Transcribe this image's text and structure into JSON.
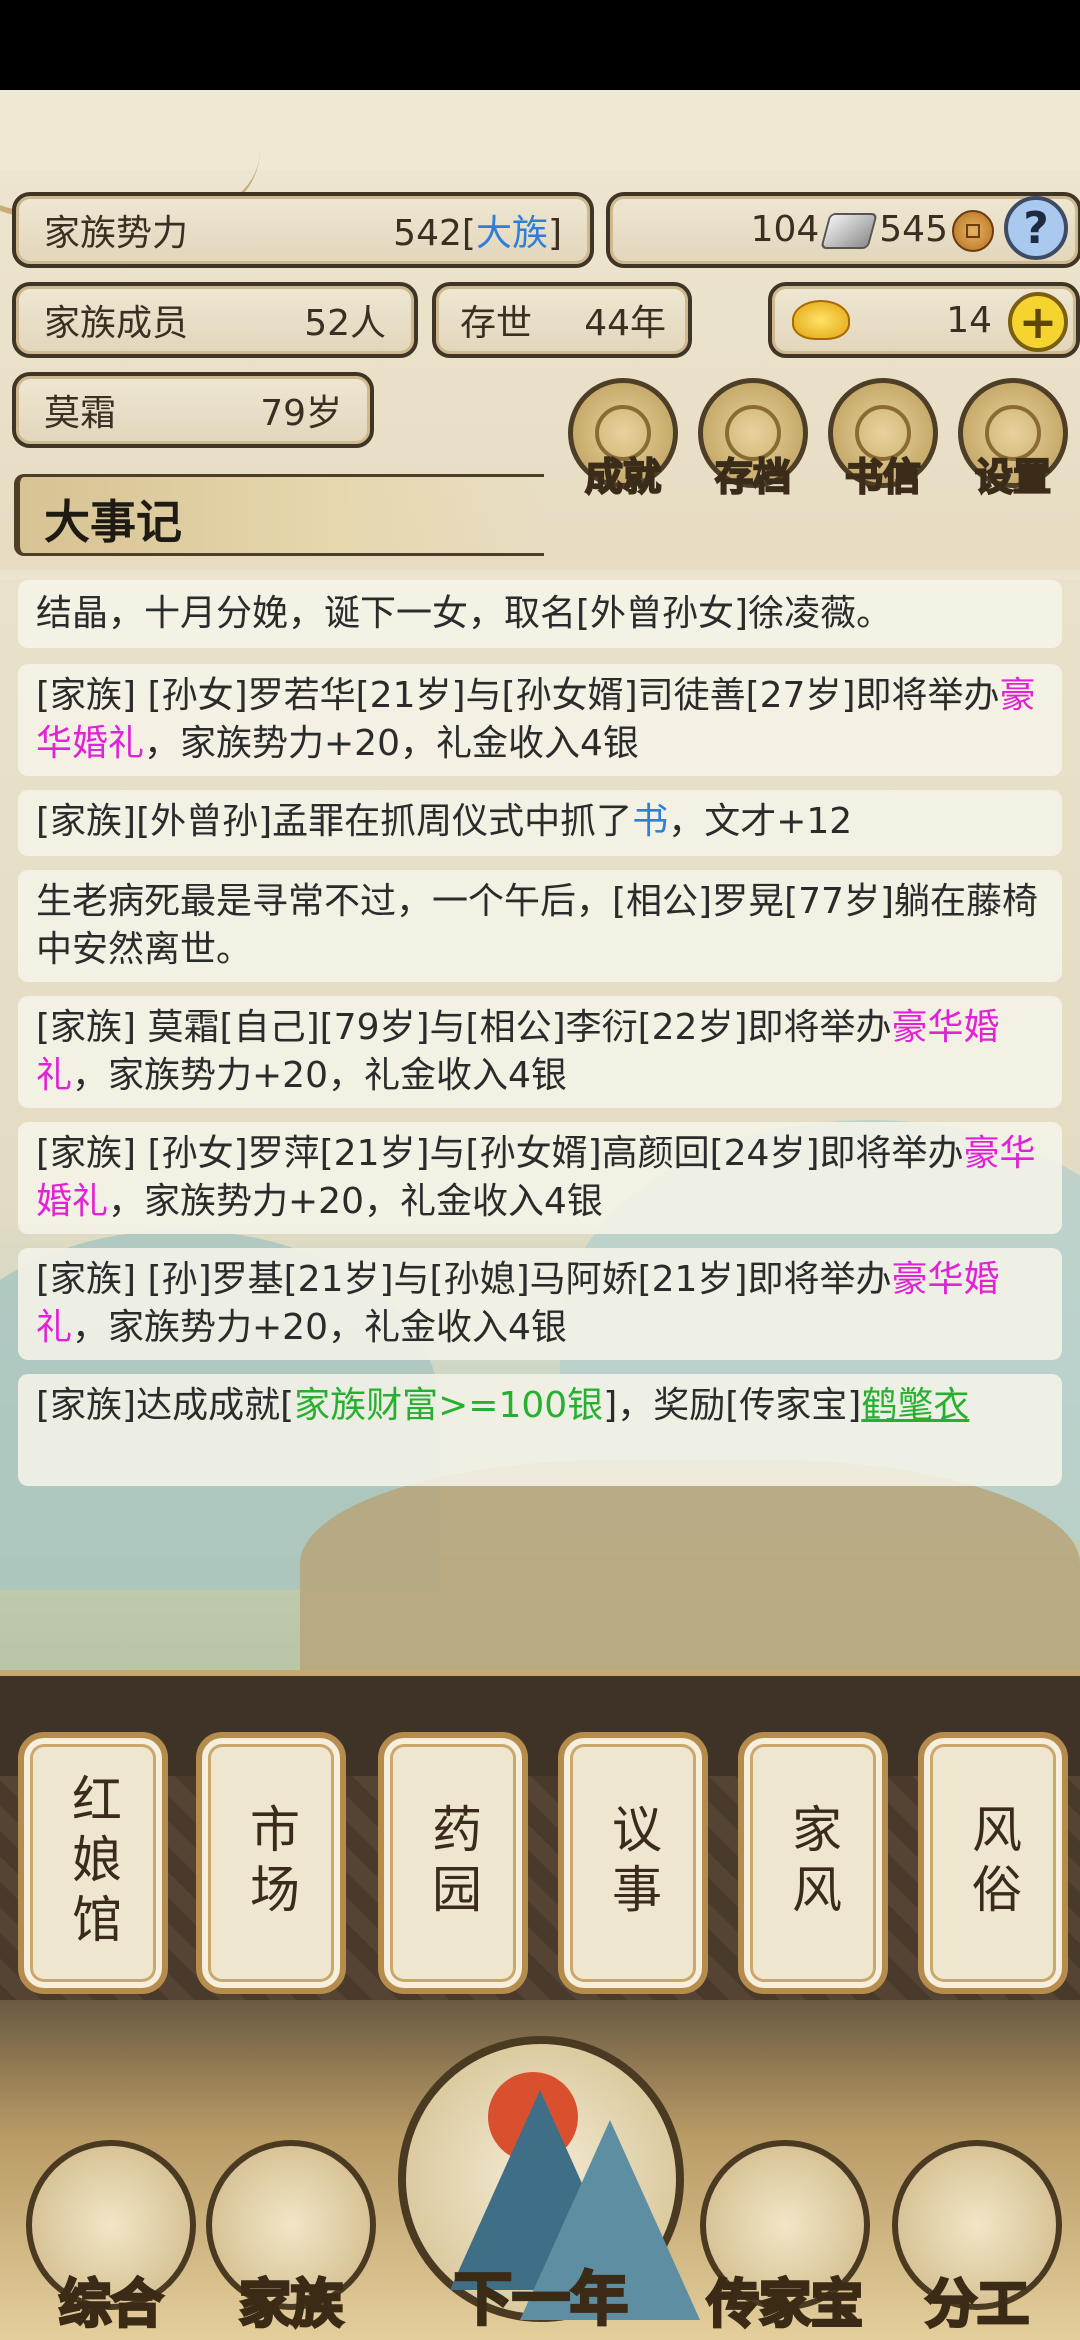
{
  "stats": {
    "power_label": "家族势力",
    "power_value": "542",
    "power_rank": "大族",
    "silver": "104",
    "copper": "545",
    "help": "?",
    "members_label": "家族成员",
    "members_value": "52人",
    "exist_label": "存世",
    "exist_value": "44年",
    "gold": "14",
    "plus": "+",
    "player_name": "莫霜",
    "player_age": "79岁"
  },
  "top_buttons": [
    "成就",
    "存档",
    "书信",
    "设置"
  ],
  "chronicle_title": "大事记",
  "entries": {
    "e0": "结晶，十月分娩，诞下一女，取名[外曾孙女]徐凌薇。",
    "e1a": "[家族] [孙女]罗若华[21岁]与[孙女婿]司徒善[27岁]即将举办",
    "e1b": "豪华婚礼",
    "e1c": "，家族势力+20，礼金收入4银",
    "e2a": "[家族][外曾孙]孟罪在抓周仪式中抓了",
    "e2b": "书",
    "e2c": "，文才+12",
    "e3": "生老病死最是寻常不过，一个午后，[相公]罗晃[77岁]躺在藤椅中安然离世。",
    "e4a": "[家族] 莫霜[自己][79岁]与[相公]李衍[22岁]即将举办",
    "e4b": "豪华婚礼",
    "e4c": "，家族势力+20，礼金收入4银",
    "e5a": "[家族] [孙女]罗萍[21岁]与[孙女婿]高颜回[24岁]即将举办",
    "e5b": "豪华婚礼",
    "e5c": "，家族势力+20，礼金收入4银",
    "e6a": "[家族] [孙]罗基[21岁]与[孙媳]马阿娇[21岁]即将举办",
    "e6b": "豪华婚礼",
    "e6c": "，家族势力+20，礼金收入4银",
    "e7a": "[家族]达成成就[",
    "e7b": "家族财富>=100银",
    "e7c": "]，奖励[传家宝]",
    "e7d": "鹤氅衣"
  },
  "tabs": [
    "红娘馆",
    "市场",
    "药园",
    "议事",
    "家风",
    "风俗"
  ],
  "nav": [
    "综合",
    "家族",
    "下一年",
    "传家宝",
    "分工"
  ],
  "colors": {
    "marriage": "#e222d6",
    "item": "#2d7fd8",
    "achievement": "#27b030"
  }
}
